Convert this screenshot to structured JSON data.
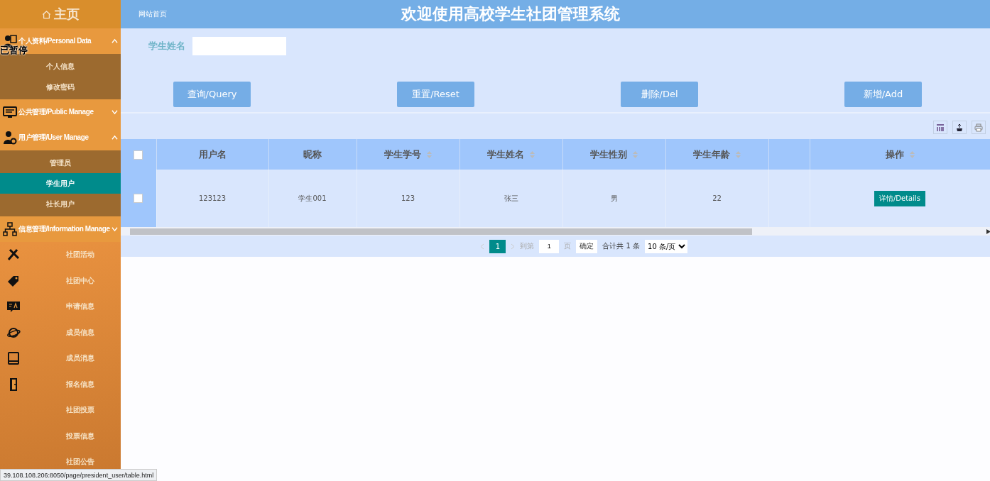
{
  "sidebar": {
    "title": "主页",
    "items": [
      {
        "kind": "group",
        "label": "个人资料/Personal Data",
        "expanded": true,
        "children": [
          {
            "label": "个人信息",
            "selected": false
          },
          {
            "label": "修改密码",
            "selected": false
          }
        ]
      },
      {
        "kind": "group",
        "label": "公共管理/Public Manage",
        "expanded": false
      },
      {
        "kind": "group",
        "label": "用户管理/User Manage",
        "expanded": true,
        "children": [
          {
            "label": "管理员",
            "selected": false
          },
          {
            "label": "学生用户",
            "selected": true
          },
          {
            "label": "社长用户",
            "selected": false
          }
        ]
      },
      {
        "kind": "group",
        "label": "信息管理/Information Manage",
        "expanded": false
      },
      {
        "kind": "link",
        "label": "社团活动",
        "has_icon": true
      },
      {
        "kind": "link",
        "label": "社团中心",
        "has_icon": true
      },
      {
        "kind": "link",
        "label": "申请信息",
        "has_icon": true
      },
      {
        "kind": "link",
        "label": "成员信息",
        "has_icon": true
      },
      {
        "kind": "link",
        "label": "成员消息",
        "has_icon": true
      },
      {
        "kind": "link",
        "label": "报名信息",
        "has_icon": true
      },
      {
        "kind": "link",
        "label": "社团投票",
        "has_icon": false
      },
      {
        "kind": "link",
        "label": "投票信息",
        "has_icon": false
      },
      {
        "kind": "link",
        "label": "社团公告",
        "has_icon": false
      }
    ]
  },
  "overlay_text": "已暂停",
  "header": {
    "breadcrumb": "网站首页",
    "title": "欢迎使用高校学生社团管理系统"
  },
  "search": {
    "label": "学生姓名"
  },
  "buttons": [
    "查询/Query",
    "重置/Reset",
    "删除/Del",
    "新增/Add"
  ],
  "table": {
    "header_checked": false,
    "columns": [
      {
        "label": "用户名",
        "sortable": false
      },
      {
        "label": "昵称",
        "sortable": false
      },
      {
        "label": "学生学号",
        "sortable": true
      },
      {
        "label": "学生姓名",
        "sortable": true
      },
      {
        "label": "学生性别",
        "sortable": true
      },
      {
        "label": "学生年龄",
        "sortable": true
      },
      {
        "sortable": false
      },
      {
        "label": "操作",
        "sortable": true
      }
    ],
    "rows": [
      {
        "checked": false,
        "cells": [
          "123123",
          "学生001",
          "123",
          "张三",
          "男",
          "22"
        ],
        "action": "详情/Details"
      }
    ]
  },
  "pagination": {
    "current": "1",
    "goto_label": "到第",
    "page_value": "1",
    "page_unit": "页",
    "confirm": "确定",
    "total": "合计共 1 条",
    "page_size": "10 条/页"
  },
  "status_bar": "39.108.108.206:8050/page/president_user/table.html"
}
